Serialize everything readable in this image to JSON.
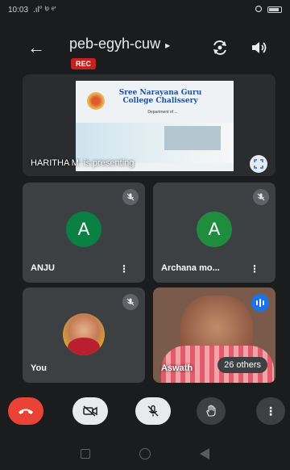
{
  "status_bar": {
    "time": "10:03",
    "signal_text": ".ıl° ᴵᵖ ᵉ'"
  },
  "meeting": {
    "title": "peb-egyh-cuw",
    "title_chevron": "▸",
    "rec_label": "REC"
  },
  "presentation": {
    "presenter_label": "HARITHA M. is presenting",
    "slide_title": "Sree Narayana Guru College Chalissery",
    "slide_subtitle": "Department of ..."
  },
  "participants": [
    {
      "name": "ANJU",
      "initial": "A",
      "avatar_color": "#0b8043",
      "muted": true
    },
    {
      "name": "Archana mo...",
      "initial": "A",
      "avatar_color": "#1e8e3e",
      "muted": true
    },
    {
      "name": "You",
      "muted": true
    },
    {
      "name": "Aswath",
      "speaking": true,
      "others_label": "26 others"
    }
  ],
  "icons": {
    "back": "←",
    "kebab": "⋮",
    "more": "⋮"
  }
}
